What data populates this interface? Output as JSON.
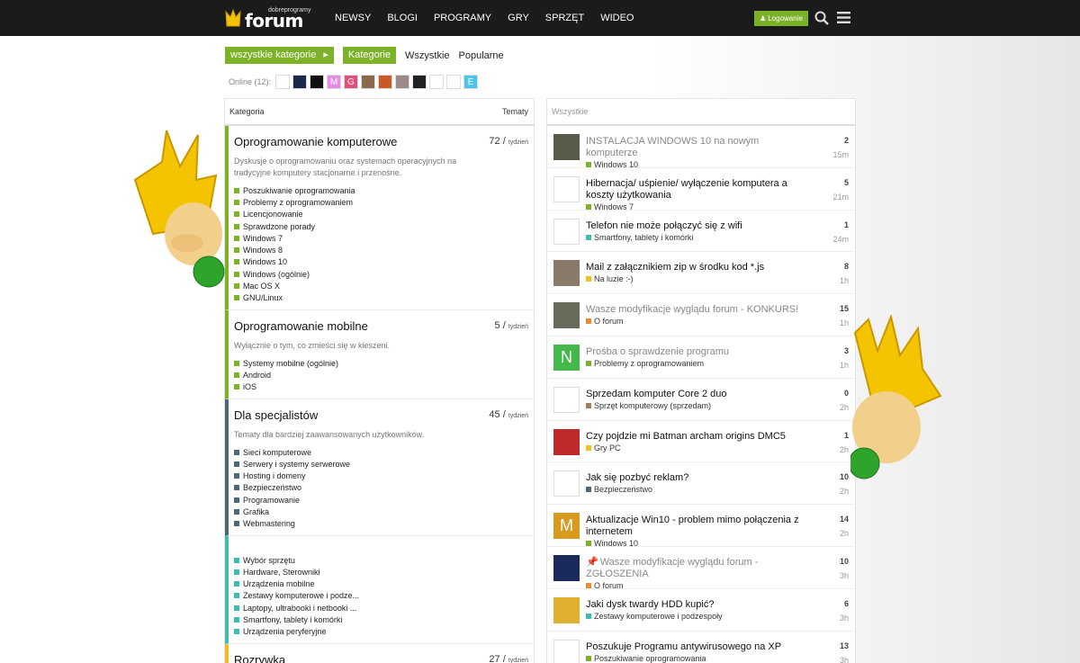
{
  "header": {
    "logo_small": "dobreprogramy",
    "logo_big": "forum",
    "nav": [
      "NEWSY",
      "BLOGI",
      "PROGRAMY",
      "GRY",
      "SPRZĘT",
      "WIDEO"
    ],
    "login_label": "Logowanie"
  },
  "filters": {
    "dropdown": "wszystkie kategorie",
    "active": "Kategorie",
    "tabs": [
      "Wszystkie",
      "Popularne"
    ]
  },
  "online": {
    "label": "Online (12):",
    "avatars": [
      {
        "letter": "",
        "color": "#ffffff"
      },
      {
        "letter": "",
        "color": "#1b2a4a"
      },
      {
        "letter": "",
        "color": "#111111"
      },
      {
        "letter": "M",
        "color": "#e58ae5"
      },
      {
        "letter": "G",
        "color": "#e0507a"
      },
      {
        "letter": "",
        "color": "#8a6a4a"
      },
      {
        "letter": "",
        "color": "#c85a2a"
      },
      {
        "letter": "",
        "color": "#9a8a8a"
      },
      {
        "letter": "",
        "color": "#222222"
      },
      {
        "letter": "",
        "color": "#ffffff"
      },
      {
        "letter": "",
        "color": "#ffffff"
      },
      {
        "letter": "E",
        "color": "#4cc3e8"
      }
    ]
  },
  "left": {
    "header_category": "Kategoria",
    "header_topics": "Tematy",
    "categories": [
      {
        "title": "Oprogramowanie komputerowe",
        "count": "72",
        "per": "tydzień",
        "color": "#7cb228",
        "desc": "Dyskusje o oprogramowaniu oraz systemach operacyjnych na tradycyjne komputery stacjonarne i przenośne.",
        "subs": [
          "Poszukiwanie oprogramowania",
          "Problemy z oprogramowaniem",
          "Licencjonowanie",
          "Sprawdzone porady",
          "Windows 7",
          "Windows 8",
          "Windows 10",
          "Windows (ogólnie)",
          "Mac OS X",
          "GNU/Linux"
        ]
      },
      {
        "title": "Oprogramowanie mobilne",
        "count": "5",
        "per": "tydzień",
        "color": "#7cb228",
        "desc": "Wyłącznie o tym, co zmieści się w kieszeni.",
        "subs": [
          "Systemy mobilne (ogólnie)",
          "Android",
          "iOS"
        ]
      },
      {
        "title": "Dla specjalistów",
        "count": "45",
        "per": "tydzień",
        "color": "#4a6a7a",
        "desc": "Tematy dla bardziej zaawansowanych użytkowników.",
        "subs": [
          "Sieci komputerowe",
          "Serwery i systemy serwerowe",
          "Hosting i domeny",
          "Bezpieczeństwo",
          "Programowanie",
          "Grafika",
          "Webmastering"
        ]
      },
      {
        "title": "",
        "count": "",
        "per": "",
        "color": "#3cbcb4",
        "desc": "",
        "subs": [
          "Wybór sprzętu",
          "Hardware, Sterowniki",
          "Urządzenia mobilne",
          "Zestawy komputerowe i podze...",
          "Laptopy, ultrabooki i netbooki ...",
          "Smartfony, tablety i komórki",
          "Urządzenia peryferyjne"
        ]
      },
      {
        "title": "Rozrywka",
        "count": "27",
        "per": "tydzień",
        "color": "#f0c020",
        "desc": "",
        "subs": []
      }
    ]
  },
  "right": {
    "header": "Wszystkie",
    "topics": [
      {
        "title": "INSTALACJA WINDOWS 10 na nowym komputerze",
        "muted": true,
        "cat": "Windows 10",
        "cat_color": "#7cb228",
        "count": "2",
        "time": "15m",
        "avatar": "#5a5a4a",
        "letter": "",
        "pinned": false
      },
      {
        "title": "Hibernacja/ uśpienie/ wyłączenie komputera a koszty użytkowania",
        "muted": false,
        "cat": "Windows 7",
        "cat_color": "#7cb228",
        "count": "5",
        "time": "21m",
        "avatar": "#ffffff",
        "letter": "",
        "pinned": false
      },
      {
        "title": "Telefon nie może połączyć się z wifi",
        "muted": false,
        "cat": "Smartfony, tablety i komórki",
        "cat_color": "#3cbcb4",
        "count": "1",
        "time": "24m",
        "avatar": "#ffffff",
        "letter": "",
        "pinned": false
      },
      {
        "title": "Mail z załącznikiem zip w środku kod *.js",
        "muted": false,
        "cat": "Na luzie :-)",
        "cat_color": "#f0c020",
        "count": "8",
        "time": "1h",
        "avatar": "#8a7a6a",
        "letter": "",
        "pinned": false
      },
      {
        "title": "Wasze modyfikacje wyglądu forum - KONKURS!",
        "muted": true,
        "cat": "O forum",
        "cat_color": "#f08a30",
        "count": "15",
        "time": "1h",
        "avatar": "#6a6a5a",
        "letter": "",
        "pinned": false
      },
      {
        "title": "Prośba o sprawdzenie programu",
        "muted": true,
        "cat": "Problemy z oprogramowaniem",
        "cat_color": "#7cb228",
        "count": "3",
        "time": "1h",
        "avatar": "#44b84a",
        "letter": "N",
        "pinned": false
      },
      {
        "title": "Sprzedam komputer Core 2 duo",
        "muted": false,
        "cat": "Sprzęt komputerowy (sprzedam)",
        "cat_color": "#a08060",
        "count": "0",
        "time": "2h",
        "avatar": "#ffffff",
        "letter": "",
        "pinned": false
      },
      {
        "title": "Czy pojdzie mi Batman archam origins DMC5",
        "muted": false,
        "cat": "Gry PC",
        "cat_color": "#f0c020",
        "count": "1",
        "time": "2h",
        "avatar": "#c02a2a",
        "letter": "",
        "pinned": false
      },
      {
        "title": "Jak się pozbyć reklam?",
        "muted": false,
        "cat": "Bezpieczeństwo",
        "cat_color": "#4a6a7a",
        "count": "10",
        "time": "2h",
        "avatar": "#ffffff",
        "letter": "",
        "pinned": false
      },
      {
        "title": "Aktualizacje Win10 - problem mimo połączenia z internetem",
        "muted": false,
        "cat": "Windows 10",
        "cat_color": "#7cb228",
        "count": "14",
        "time": "2h",
        "avatar": "#d99a20",
        "letter": "M",
        "pinned": false
      },
      {
        "title": "Wasze modyfikacje wyglądu forum - ZGŁOSZENIA",
        "muted": true,
        "cat": "O forum",
        "cat_color": "#f08a30",
        "count": "10",
        "time": "3h",
        "avatar": "#1a2a5a",
        "letter": "",
        "pinned": true
      },
      {
        "title": "Jaki dysk twardy HDD kupić?",
        "muted": false,
        "cat": "Zestawy komputerowe i podzespoły",
        "cat_color": "#3cbcb4",
        "count": "6",
        "time": "3h",
        "avatar": "#e0b030",
        "letter": "",
        "pinned": false
      },
      {
        "title": "Poszukuje Programu antywirusowego na XP",
        "muted": false,
        "cat": "Poszukiwanie oprogramowania",
        "cat_color": "#7cb228",
        "count": "13",
        "time": "3h",
        "avatar": "#ffffff",
        "letter": "",
        "pinned": false
      }
    ]
  }
}
